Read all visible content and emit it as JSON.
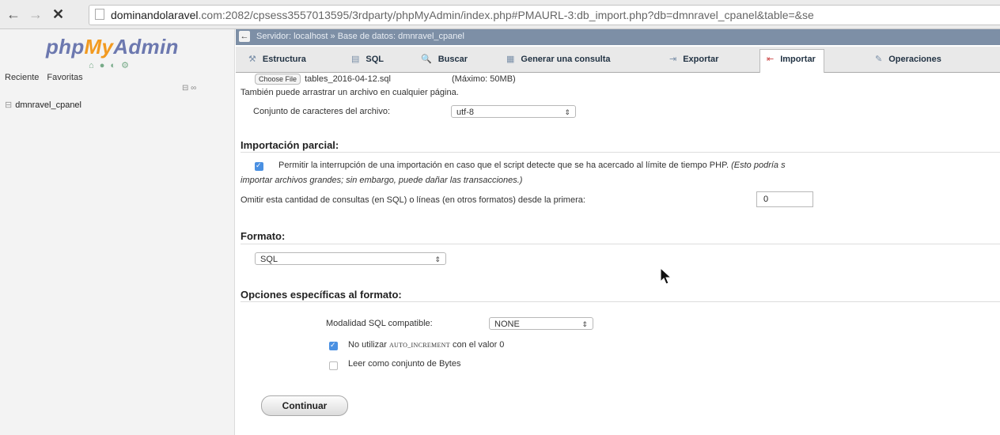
{
  "browser": {
    "back_icon": "←",
    "forward_icon": "→",
    "stop_icon": "✕",
    "url_host": "dominandolaravel",
    "url_rest": ".com:2082/cpsess3557013595/3rdparty/phpMyAdmin/index.php#PMAURL-3:db_import.php?db=dmnravel_cpanel&table=&se"
  },
  "sidebar": {
    "logo_prefix": "php",
    "logo_highlight": "My",
    "logo_suffix": "Admin",
    "quick_icons": "⌂ ● ◐ ⚙",
    "recent_label": "Reciente",
    "favorites_label": "Favoritas",
    "collapse_icon": "⊟ ∞",
    "db_name": "dmnravel_cpanel",
    "db_icon": "⊟"
  },
  "serverbar": {
    "back": "←",
    "crumbs": "Servidor: localhost » Base de datos: dmnravel_cpanel"
  },
  "tabs": [
    {
      "label": "Estructura",
      "icon": "⚒"
    },
    {
      "label": "SQL",
      "icon": "▤"
    },
    {
      "label": "Buscar",
      "icon": "🔍"
    },
    {
      "label": "Generar una consulta",
      "icon": "▦"
    },
    {
      "label": "Exportar",
      "icon": "⇥"
    },
    {
      "label": "Importar",
      "icon": "⇤"
    },
    {
      "label": "Operaciones",
      "icon": "✎"
    }
  ],
  "file": {
    "choose_button": "Choose File",
    "filename": "tables_2016-04-12.sql",
    "max_size": "(Máximo: 50MB)",
    "drag_hint": "También puede arrastrar un archivo en cualquier página.",
    "charset_label": "Conjunto de caracteres del archivo:",
    "charset_value": "utf-8"
  },
  "partial": {
    "title": "Importación parcial:",
    "allow_interrupt_label": "Permitir la interrupción de una importación en caso que el script detecte que se ha acercado al límite de tiempo PHP.",
    "allow_interrupt_note": "(Esto podría s",
    "allow_interrupt_note2": "importar archivos grandes; sin embargo, puede dañar las transacciones.)",
    "allow_interrupt_checked": true,
    "skip_label": "Omitir esta cantidad de consultas (en SQL) o líneas (en otros formatos) desde la primera:",
    "skip_value": "0"
  },
  "format": {
    "title": "Formato:",
    "value": "SQL"
  },
  "format_options": {
    "title": "Opciones específicas al formato:",
    "sql_compat_label": "Modalidad SQL compatible:",
    "sql_compat_value": "NONE",
    "no_auto_inc_prefix": "No utilizar",
    "no_auto_inc_code": "AUTO_INCREMENT",
    "no_auto_inc_suffix": "con el valor 0",
    "no_auto_inc_checked": true,
    "bytes_label": "Leer como conjunto de Bytes",
    "bytes_checked": false
  },
  "submit_label": "Continuar",
  "select_arrow": "⇕"
}
